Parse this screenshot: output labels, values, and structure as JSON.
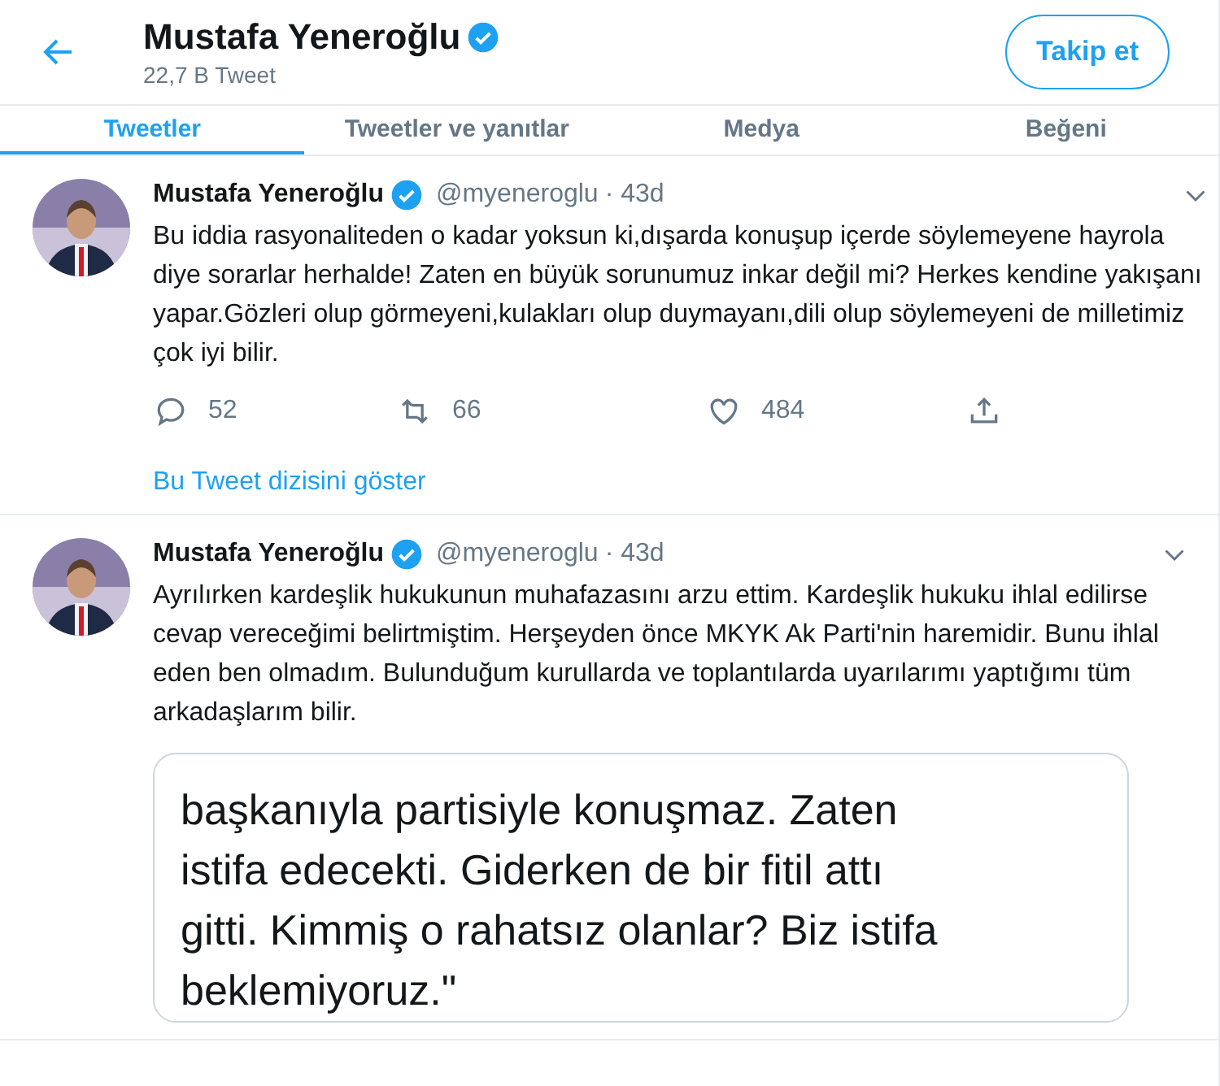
{
  "header": {
    "name": "Mustafa Yeneroğlu",
    "tweet_count": "22,7 B Tweet",
    "follow_button": "Takip et"
  },
  "tabs": [
    {
      "label": "Tweetler",
      "selected": true
    },
    {
      "label": "Tweetler ve yanıtlar",
      "selected": false
    },
    {
      "label": "Medya",
      "selected": false
    },
    {
      "label": "Beğeni",
      "selected": false
    }
  ],
  "tweets": [
    {
      "name": "Mustafa Yeneroğlu",
      "handle": "@myeneroglu",
      "time": "· 43d",
      "text": "Bu iddia rasyonaliteden o kadar yoksun ki,dışarda konuşup içerde söylemeyene hayrola diye sorarlar herhalde! Zaten en büyük sorunumuz inkar değil mi? Herkes kendine yakışanı yapar.Gözleri olup görmeyeni,kulakları olup duymayanı,dili olup söylemeyeni de milletimiz çok iyi bilir.",
      "actions": {
        "replies": "52",
        "retweets": "66",
        "likes": "484"
      },
      "thread_link": "Bu Tweet dizisini göster"
    },
    {
      "name": "Mustafa Yeneroğlu",
      "handle": "@myeneroglu",
      "time": "· 43d",
      "text": "Ayrılırken kardeşlik hukukunun muhafazasını arzu ettim. Kardeşlik hukuku ihlal edilirse cevap vereceğimi belirtmiştim. Herşeyden önce MKYK Ak Parti'nin haremidir. Bunu ihlal eden ben olmadım. Bulunduğum kurullarda ve toplantılarda uyarılarımı yaptığımı tüm arkadaşlarım bilir.",
      "image_lines": [
        "başkanıyla partisiyle konuşmaz. Zaten",
        "istifa edecekti. Giderken de bir fitil attı",
        "gitti. Kimmiş o rahatsız olanlar? Biz istifa",
        "beklemiyoruz.\""
      ]
    }
  ]
}
